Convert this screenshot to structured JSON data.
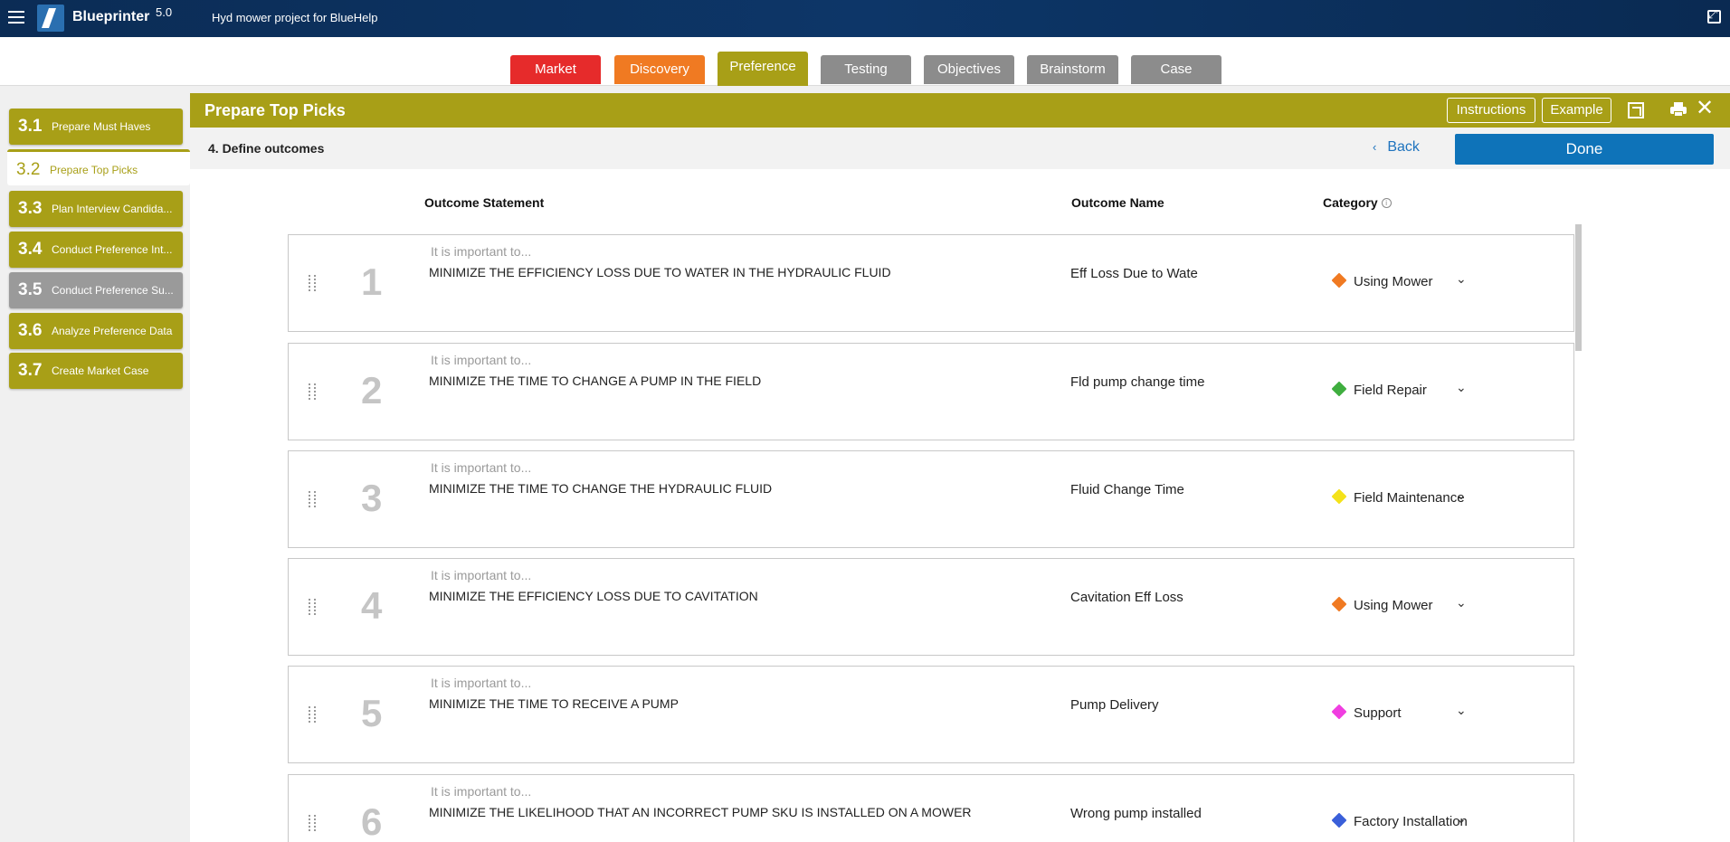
{
  "topbar": {
    "app_name": "Blueprinter",
    "app_version": "5.0",
    "project_title": "Hyd mower project for BlueHelp"
  },
  "phase_tabs": [
    {
      "label": "Market",
      "color": "#e62b2b"
    },
    {
      "label": "Discovery",
      "color": "#f07a22"
    },
    {
      "label": "Preference",
      "color": "#a89f17",
      "active": true
    },
    {
      "label": "Testing",
      "color": "#8c8c8c"
    },
    {
      "label": "Objectives",
      "color": "#8c8c8c"
    },
    {
      "label": "Brainstorm",
      "color": "#8c8c8c"
    },
    {
      "label": "Case",
      "color": "#8c8c8c"
    }
  ],
  "sidebar": {
    "steps": [
      {
        "num": "3.1",
        "label": "Prepare Must Haves",
        "color": "#a89f17"
      },
      {
        "num": "3.2",
        "label": "Prepare Top Picks",
        "active": true
      },
      {
        "num": "3.3",
        "label": "Plan Interview Candida...",
        "color": "#a89f17"
      },
      {
        "num": "3.4",
        "label": "Conduct Preference Int...",
        "color": "#a89f17"
      },
      {
        "num": "3.5",
        "label": "Conduct Preference Su...",
        "color": "#9a9a9a"
      },
      {
        "num": "3.6",
        "label": "Analyze Preference Data",
        "color": "#a89f17"
      },
      {
        "num": "3.7",
        "label": "Create Market Case",
        "color": "#a89f17"
      }
    ]
  },
  "panel": {
    "title": "Prepare Top Picks",
    "instructions_label": "Instructions",
    "example_label": "Example",
    "close_glyph": "✕"
  },
  "substep": {
    "title": "4. Define outcomes",
    "back_label": "Back",
    "done_label": "Done"
  },
  "columns": {
    "statement": "Outcome Statement",
    "name": "Outcome Name",
    "category": "Category"
  },
  "outcomes": [
    {
      "num": "1",
      "prefix": "It is important to...",
      "statement": "MINIMIZE THE EFFICIENCY LOSS DUE TO WATER IN THE HYDRAULIC FLUID",
      "name": "Eff Loss Due to Wate",
      "category": "Using Mower",
      "cat_color": "#f07a22"
    },
    {
      "num": "2",
      "prefix": "It is important to...",
      "statement": "MINIMIZE THE TIME TO CHANGE A PUMP IN THE FIELD",
      "name": "Fld pump change time",
      "category": "Field Repair",
      "cat_color": "#3fae3f"
    },
    {
      "num": "3",
      "prefix": "It is important to...",
      "statement": "MINIMIZE THE TIME TO CHANGE THE HYDRAULIC FLUID",
      "name": "Fluid Change Time",
      "category": "Field Maintenance",
      "cat_color": "#f4e21a"
    },
    {
      "num": "4",
      "prefix": "It is important to...",
      "statement": "MINIMIZE THE EFFICIENCY LOSS DUE TO CAVITATION",
      "name": "Cavitation Eff Loss",
      "category": "Using Mower",
      "cat_color": "#f07a22"
    },
    {
      "num": "5",
      "prefix": "It is important to...",
      "statement": "MINIMIZE THE TIME TO RECEIVE A PUMP",
      "name": "Pump Delivery",
      "category": "Support",
      "cat_color": "#f03ee0"
    },
    {
      "num": "6",
      "prefix": "It is important to...",
      "statement": "MINIMIZE THE LIKELIHOOD THAT AN INCORRECT PUMP SKU IS INSTALLED ON A MOWER",
      "name": "Wrong pump installed",
      "category": "Factory Installation",
      "cat_color": "#3a5fd9"
    }
  ]
}
